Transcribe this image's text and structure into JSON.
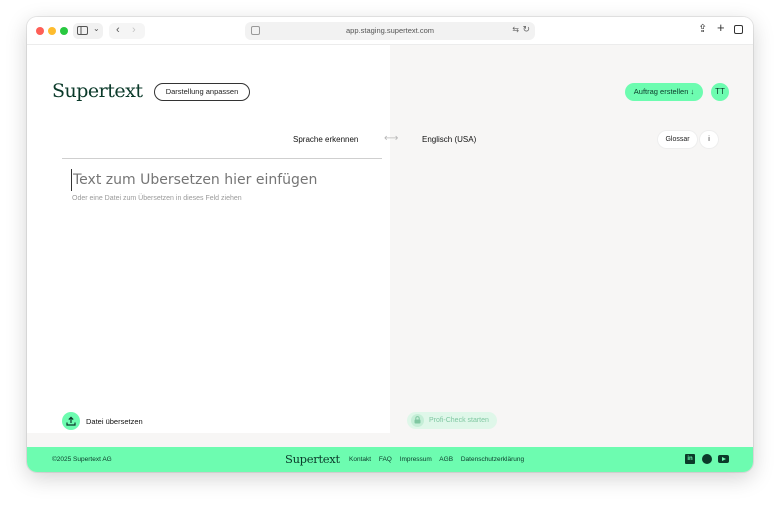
{
  "browser": {
    "url": "app.staging.supertext.com"
  },
  "header": {
    "logo": "Supertext",
    "display_button": "Darstellung anpassen",
    "order_button": "Auftrag erstellen ↓",
    "avatar_initials": "TT"
  },
  "languages": {
    "source": "Sprache erkennen",
    "target": "Englisch (USA)",
    "glossary_button": "Glossar",
    "info_button": "i"
  },
  "editor": {
    "placeholder": "Text zum Übersetzen hier einfügen",
    "hint": "Oder eine Datei zum Übersetzen in dieses Feld ziehen",
    "upload_label": "Datei übersetzen",
    "profi_check": "Profi-Check starten"
  },
  "footer": {
    "copyright": "©2025 Supertext AG",
    "logo": "Supertext",
    "links": [
      "Kontakt",
      "FAQ",
      "Impressum",
      "AGB",
      "Datenschutzerklärung"
    ],
    "linkedin_glyph": "in"
  },
  "colors": {
    "accent": "#6dfcb0",
    "brand_dark": "#0b3a2a",
    "right_pane_bg": "#f7f6f5"
  },
  "icons": [
    "sidebar-icon",
    "back-icon",
    "forward-icon",
    "translate-icon",
    "reload-icon",
    "share-icon",
    "new-tab-icon",
    "tabs-overview-icon",
    "swap-icon",
    "upload-icon",
    "lock-icon",
    "linkedin-icon",
    "social-icon",
    "youtube-icon"
  ]
}
